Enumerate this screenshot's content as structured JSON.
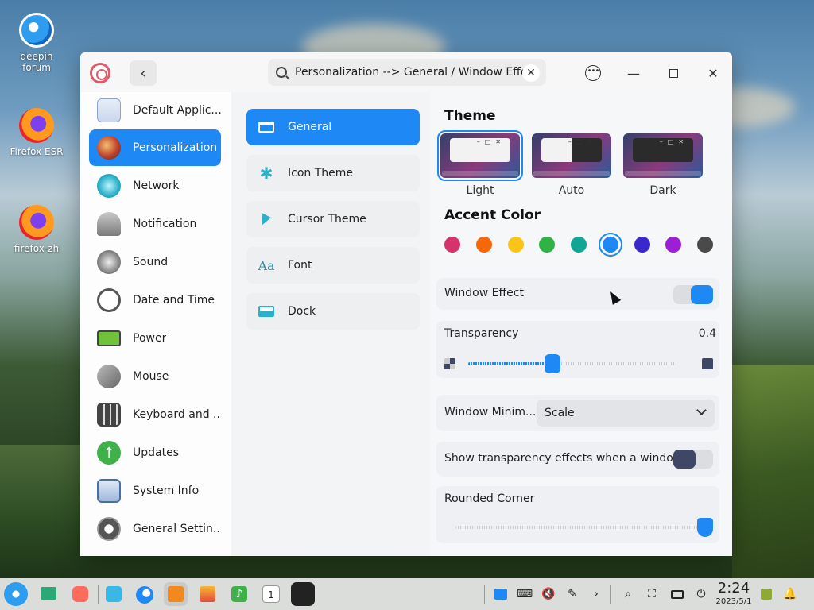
{
  "desktop": {
    "icons": [
      {
        "label": "deepin\nforum",
        "line1": "deepin",
        "line2": "forum"
      },
      {
        "label": "Firefox ESR"
      },
      {
        "label": "firefox-zh"
      }
    ]
  },
  "window": {
    "search": {
      "value": "Personalization --> General / Window Effect"
    }
  },
  "sidebar": {
    "items": [
      {
        "label": "Default Applic...",
        "color": "#5b8fd6"
      },
      {
        "label": "Personalization",
        "color": "#c2402a"
      },
      {
        "label": "Network",
        "color": "#2ab0c8"
      },
      {
        "label": "Notification",
        "color": "#8a8a8a"
      },
      {
        "label": "Sound",
        "color": "#666666"
      },
      {
        "label": "Date and Time",
        "color": "#555555"
      },
      {
        "label": "Power",
        "color": "#6fc23a"
      },
      {
        "label": "Mouse",
        "color": "#777777"
      },
      {
        "label": "Keyboard and ...",
        "color": "#555555"
      },
      {
        "label": "Updates",
        "color": "#3fb04a"
      },
      {
        "label": "System Info",
        "color": "#4a6fa5"
      },
      {
        "label": "General Settin...",
        "color": "#555555"
      }
    ]
  },
  "middle": {
    "items": [
      {
        "label": "General"
      },
      {
        "label": "Icon Theme"
      },
      {
        "label": "Cursor Theme"
      },
      {
        "label": "Font",
        "icon_text": "Aa"
      },
      {
        "label": "Dock"
      }
    ]
  },
  "content": {
    "theme_title": "Theme",
    "themes": [
      {
        "label": "Light",
        "selected": true
      },
      {
        "label": "Auto",
        "selected": false
      },
      {
        "label": "Dark",
        "selected": false
      }
    ],
    "accent_title": "Accent Color",
    "accent_colors": [
      "#d6336c",
      "#f76707",
      "#fcc419",
      "#2fb344",
      "#12a594",
      "#1e88f5",
      "#3b28cc",
      "#9c1fd6",
      "#4a4a4a"
    ],
    "accent_selected_index": 5,
    "window_effect": {
      "label": "Window Effect",
      "enabled": true
    },
    "transparency": {
      "label": "Transparency",
      "value": "0.4",
      "fraction": 0.4
    },
    "window_minimize": {
      "label": "Window Minim...",
      "value": "Scale"
    },
    "transparency_effects": {
      "label": "Show transparency effects when a windo...",
      "enabled": false
    },
    "rounded_corner": {
      "label": "Rounded Corner",
      "fraction": 1.0
    }
  },
  "taskbar": {
    "time": "2:24",
    "date": "2023/5/1"
  }
}
